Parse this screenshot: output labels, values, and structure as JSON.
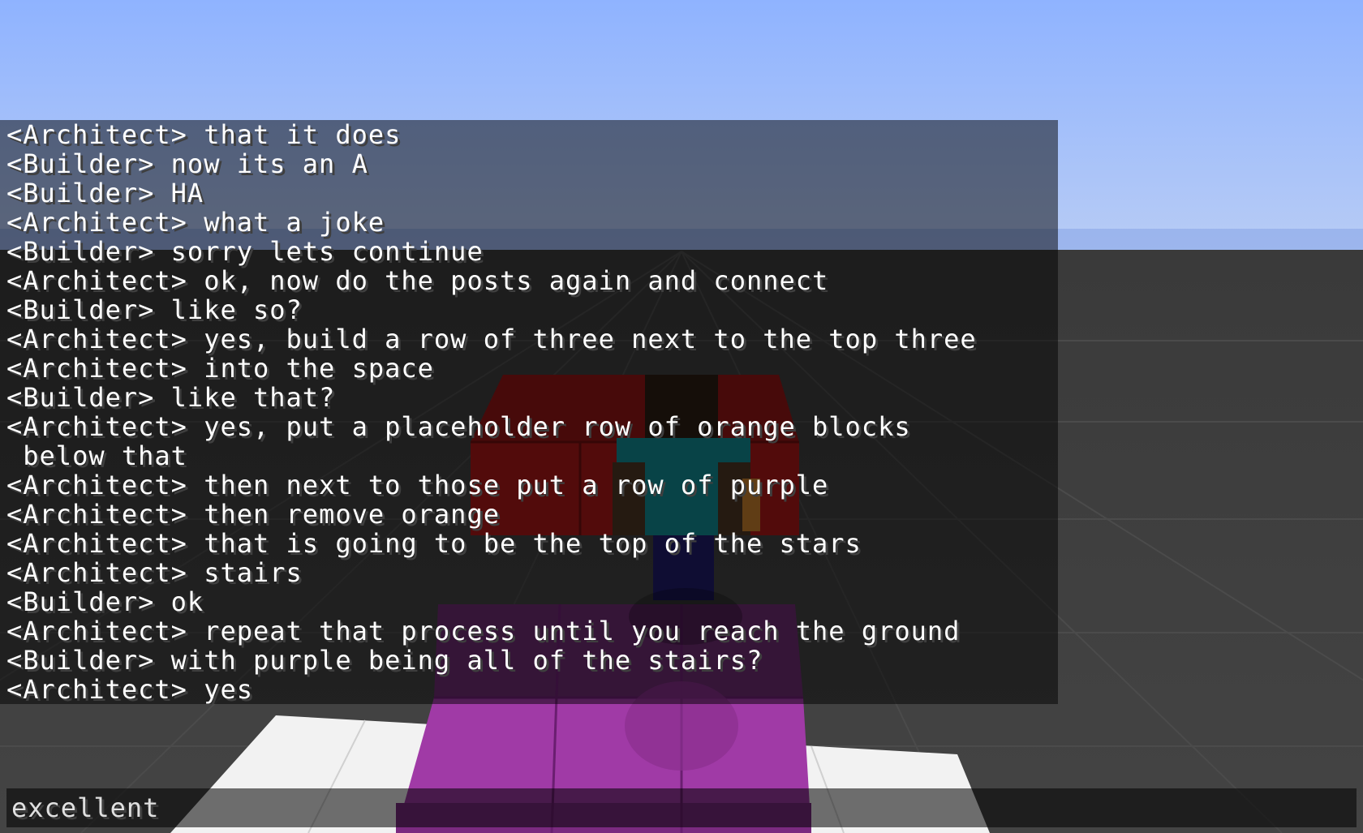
{
  "chat": {
    "lines": [
      "<Architect> that it does",
      "<Builder> now its an A",
      "<Builder> HA",
      "<Architect> what a joke",
      "<Builder> sorry lets continue",
      "<Architect> ok, now do the posts again and connect",
      "<Builder> like so?",
      "<Architect> yes, build a row of three next to the top three",
      "<Architect> into the space",
      "<Builder> like that?",
      "<Architect> yes, put a placeholder row of orange blocks",
      " below that",
      "<Architect> then next to those put a row of purple",
      "<Architect> then remove orange",
      "<Architect> that is going to be the top of the stars",
      "<Architect> stairs",
      "<Builder> ok",
      "<Architect> repeat that process until you reach the ground",
      "<Builder> with purple being all of the stairs?",
      "<Architect> yes"
    ]
  },
  "input": {
    "value": "excellent"
  },
  "colors": {
    "sky_top": "#8fb3ff",
    "sky_bottom": "#b8ccf5",
    "ground": "#3c3c3c",
    "grid_line": "#4a4a4a",
    "white_floor": "#f2f2f2",
    "red_block": "#8e1414",
    "purple_block": "#a03aa6",
    "chat_text": "#ffffff"
  }
}
